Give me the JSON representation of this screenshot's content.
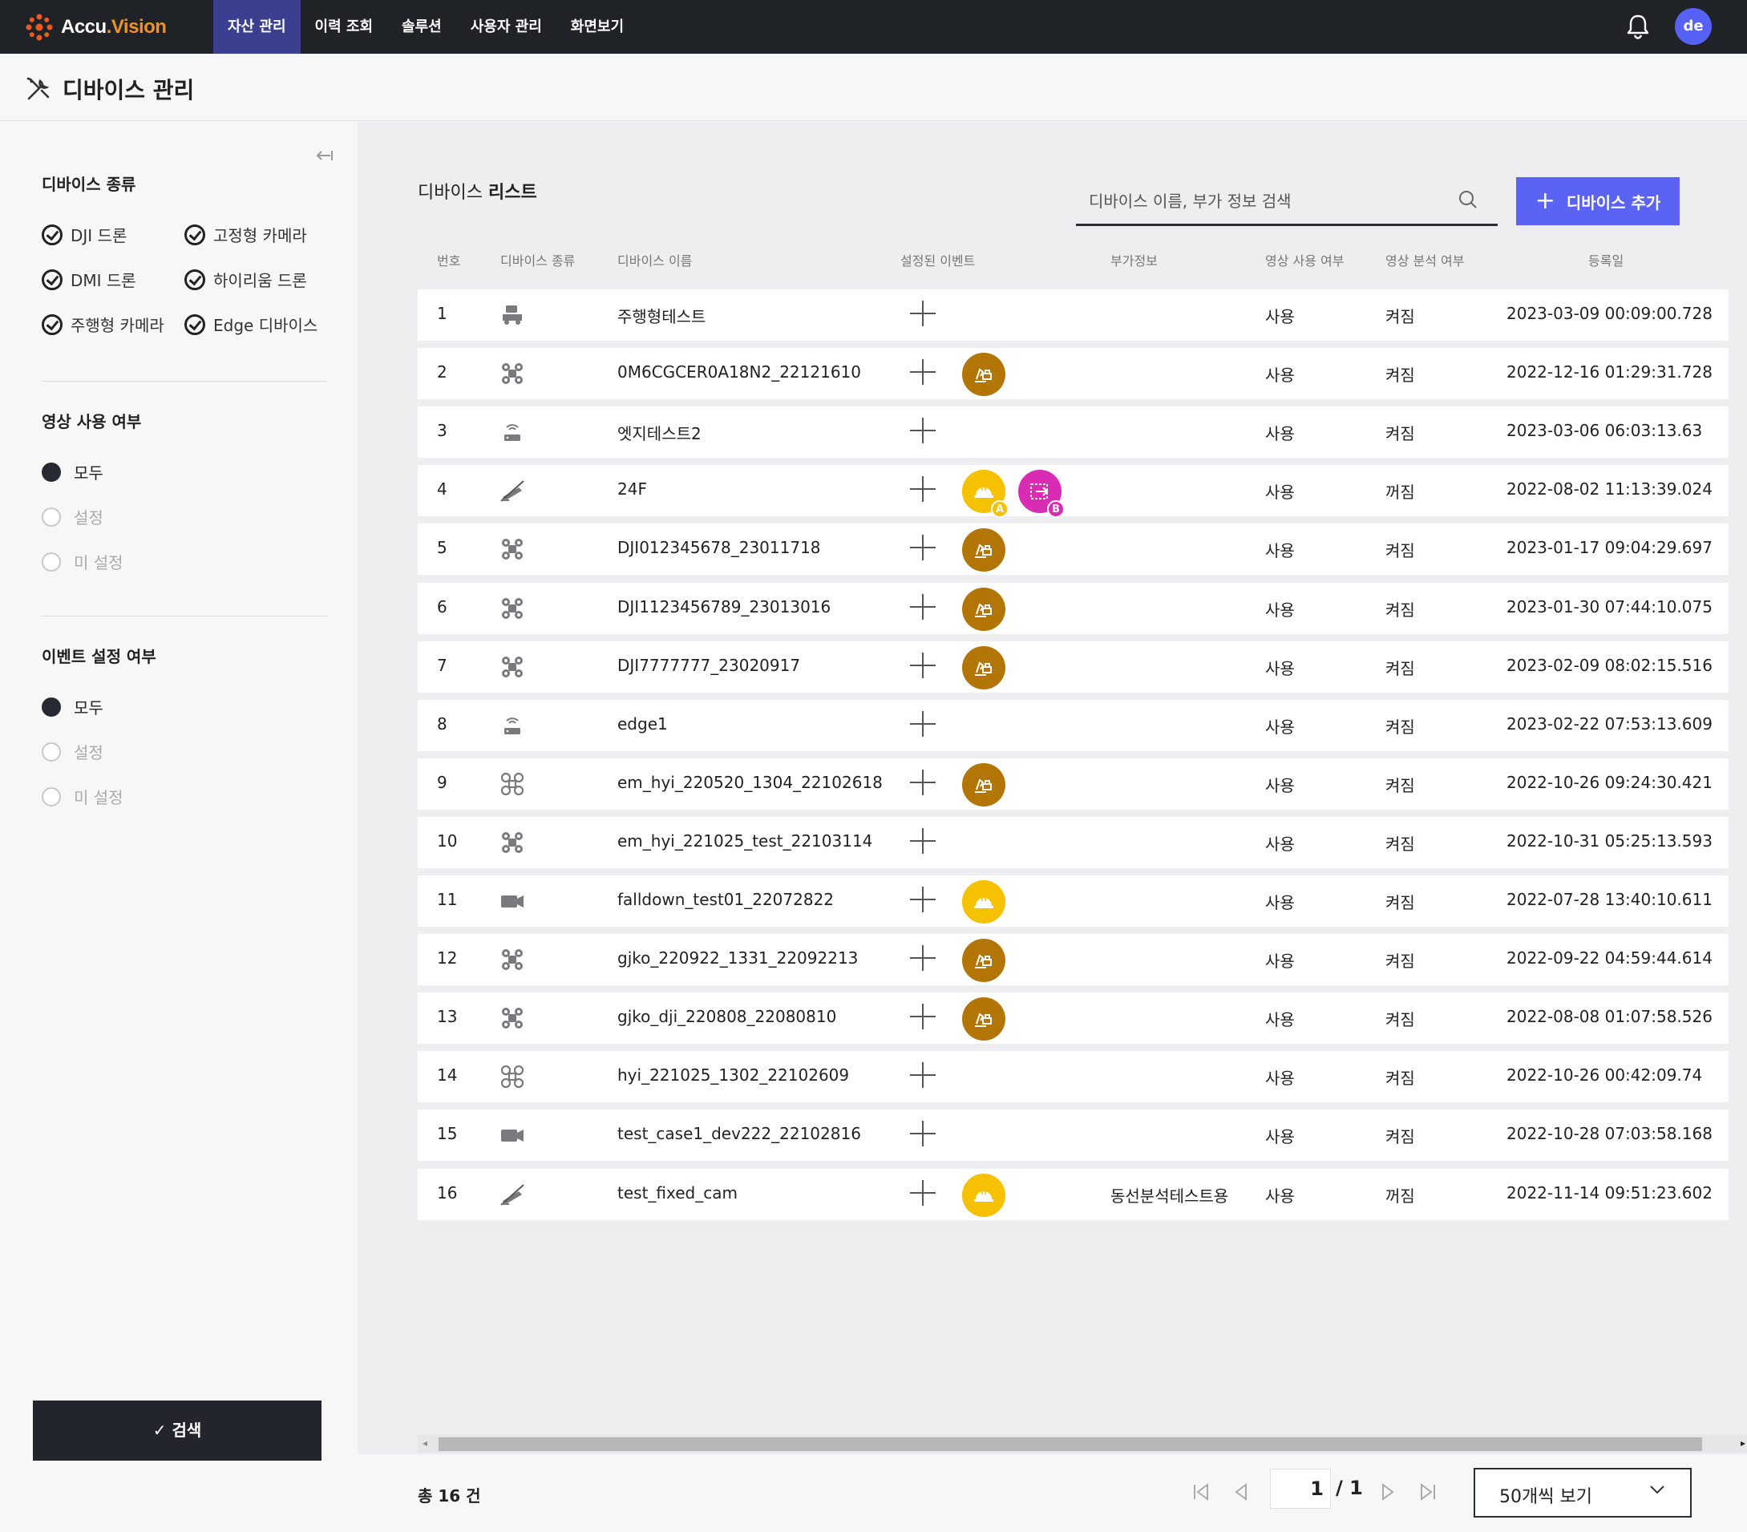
{
  "app": {
    "logo_text": "Accu",
    "logo_accent": ".Vision",
    "nav": [
      {
        "label": "자산 관리",
        "active": true
      },
      {
        "label": "이력 조회",
        "active": false
      },
      {
        "label": "솔루션",
        "active": false
      },
      {
        "label": "사용자 관리",
        "active": false
      },
      {
        "label": "화면보기",
        "active": false
      }
    ],
    "avatar_initials": "de",
    "icons": {
      "notifications": "bell-icon"
    }
  },
  "page": {
    "title": "디바이스 관리",
    "icon": "tools-icon"
  },
  "sidebar": {
    "device_type_heading": "디바이스 종류",
    "device_types": [
      {
        "label": "DJI 드론",
        "checked": true
      },
      {
        "label": "고정형 카메라",
        "checked": true
      },
      {
        "label": "DMI 드론",
        "checked": true
      },
      {
        "label": "하이리움 드론",
        "checked": true
      },
      {
        "label": "주행형 카메라",
        "checked": true
      },
      {
        "label": "Edge 디바이스",
        "checked": true
      }
    ],
    "video_use_heading": "영상 사용 여부",
    "video_use_options": [
      {
        "label": "모두",
        "selected": true
      },
      {
        "label": "설정",
        "selected": false
      },
      {
        "label": "미 설정",
        "selected": false
      }
    ],
    "event_heading": "이벤트 설정 여부",
    "event_options": [
      {
        "label": "모두",
        "selected": true
      },
      {
        "label": "설정",
        "selected": false
      },
      {
        "label": "미 설정",
        "selected": false
      }
    ],
    "search_button": "✓ 검색"
  },
  "main": {
    "list_title_prefix": "디바이스 ",
    "list_title_bold": "리스트",
    "search_placeholder": "디바이스 이름, 부가 정보 검색",
    "add_button": "디바이스 추가",
    "columns": [
      "번호",
      "디바이스 종류",
      "디바이스 이름",
      "설정된 이벤트",
      "부가정보",
      "영상 사용 여부",
      "영상 분석 여부",
      "등록일"
    ],
    "rows": [
      {
        "no": "1",
        "type": "driving-camera",
        "name": "주행형테스트",
        "events": [],
        "extra": "",
        "video_use": "사용",
        "analysis": "켜짐",
        "registered": "2023-03-09 00:09:00.728"
      },
      {
        "no": "2",
        "type": "drone",
        "name": "0M6CGCER0A18N2_22121610",
        "events": [
          {
            "kind": "excavator",
            "color": "dark"
          }
        ],
        "extra": "",
        "video_use": "사용",
        "analysis": "켜짐",
        "registered": "2022-12-16 01:29:31.728"
      },
      {
        "no": "3",
        "type": "edge",
        "name": "엣지테스트2",
        "events": [],
        "extra": "",
        "video_use": "사용",
        "analysis": "켜짐",
        "registered": "2023-03-06 06:03:13.63"
      },
      {
        "no": "4",
        "type": "fixed-camera",
        "name": "24F",
        "events": [
          {
            "kind": "helmet",
            "color": "yellow",
            "tag": "A"
          },
          {
            "kind": "zone",
            "color": "magenta",
            "tag": "B"
          }
        ],
        "extra": "",
        "video_use": "사용",
        "analysis": "꺼짐",
        "registered": "2022-08-02 11:13:39.024"
      },
      {
        "no": "5",
        "type": "drone",
        "name": "DJI012345678_23011718",
        "events": [
          {
            "kind": "excavator",
            "color": "dark"
          }
        ],
        "extra": "",
        "video_use": "사용",
        "analysis": "켜짐",
        "registered": "2023-01-17 09:04:29.697"
      },
      {
        "no": "6",
        "type": "drone",
        "name": "DJI1123456789_23013016",
        "events": [
          {
            "kind": "excavator",
            "color": "dark"
          }
        ],
        "extra": "",
        "video_use": "사용",
        "analysis": "켜짐",
        "registered": "2023-01-30 07:44:10.075"
      },
      {
        "no": "7",
        "type": "drone",
        "name": "DJI7777777_23020917",
        "events": [
          {
            "kind": "excavator",
            "color": "dark"
          }
        ],
        "extra": "",
        "video_use": "사용",
        "analysis": "켜짐",
        "registered": "2023-02-09 08:02:15.516"
      },
      {
        "no": "8",
        "type": "edge",
        "name": "edge1",
        "events": [],
        "extra": "",
        "video_use": "사용",
        "analysis": "켜짐",
        "registered": "2023-02-22 07:53:13.609"
      },
      {
        "no": "9",
        "type": "drone-alt",
        "name": "em_hyi_220520_1304_22102618",
        "events": [
          {
            "kind": "excavator",
            "color": "dark"
          }
        ],
        "extra": "",
        "video_use": "사용",
        "analysis": "켜짐",
        "registered": "2022-10-26 09:24:30.421"
      },
      {
        "no": "10",
        "type": "drone",
        "name": "em_hyi_221025_test_22103114",
        "events": [],
        "extra": "",
        "video_use": "사용",
        "analysis": "켜짐",
        "registered": "2022-10-31 05:25:13.593"
      },
      {
        "no": "11",
        "type": "camera",
        "name": "falldown_test01_22072822",
        "events": [
          {
            "kind": "helmet",
            "color": "yellow"
          }
        ],
        "extra": "",
        "video_use": "사용",
        "analysis": "켜짐",
        "registered": "2022-07-28 13:40:10.611"
      },
      {
        "no": "12",
        "type": "drone",
        "name": "gjko_220922_1331_22092213",
        "events": [
          {
            "kind": "excavator",
            "color": "dark"
          }
        ],
        "extra": "",
        "video_use": "사용",
        "analysis": "켜짐",
        "registered": "2022-09-22 04:59:44.614"
      },
      {
        "no": "13",
        "type": "drone",
        "name": "gjko_dji_220808_22080810",
        "events": [
          {
            "kind": "excavator",
            "color": "dark"
          }
        ],
        "extra": "",
        "video_use": "사용",
        "analysis": "켜짐",
        "registered": "2022-08-08 01:07:58.526"
      },
      {
        "no": "14",
        "type": "drone-alt",
        "name": "hyi_221025_1302_22102609",
        "events": [],
        "extra": "",
        "video_use": "사용",
        "analysis": "켜짐",
        "registered": "2022-10-26 00:42:09.74"
      },
      {
        "no": "15",
        "type": "camera",
        "name": "test_case1_dev222_22102816",
        "events": [],
        "extra": "",
        "video_use": "사용",
        "analysis": "켜짐",
        "registered": "2022-10-28 07:03:58.168"
      },
      {
        "no": "16",
        "type": "fixed-camera",
        "name": "test_fixed_cam",
        "events": [
          {
            "kind": "helmet",
            "color": "yellow"
          }
        ],
        "extra": "동선분석테스트용",
        "video_use": "사용",
        "analysis": "꺼짐",
        "registered": "2022-11-14 09:51:23.602"
      }
    ]
  },
  "footer": {
    "total": "총 16 건",
    "current_page": "1",
    "total_pages": "/ 1",
    "page_size": "50개씩 보기"
  },
  "colors": {
    "topbar": "#1f2227",
    "nav_active": "#3a3f8f",
    "accent": "#5b63f5",
    "logo_accent": "#f29224",
    "event_dark": "#b27506",
    "event_yellow": "#f6c100",
    "event_magenta": "#da2bb5"
  }
}
